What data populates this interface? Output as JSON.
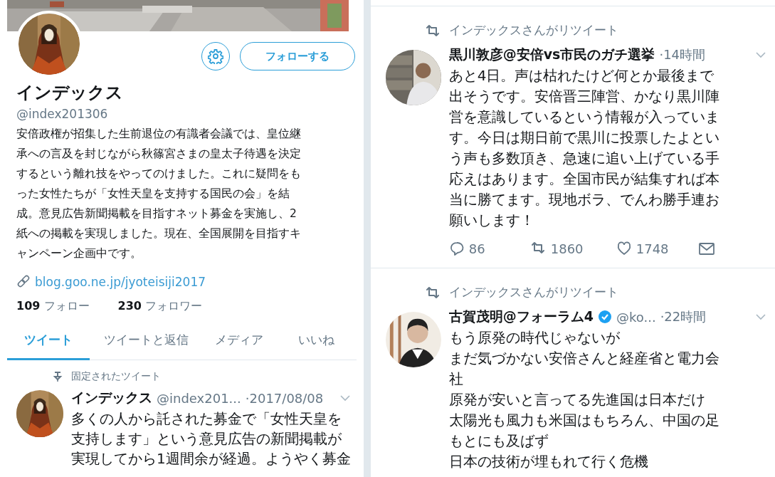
{
  "profile": {
    "name": "インデックス",
    "handle": "@index201306",
    "follow_button": "フォローする",
    "bio_lines": [
      "安倍政権が招集した生前退位の有識者会議では、皇位継",
      "承への言及を封じながら秋篠宮さまの皇太子待遇を決定",
      "するという離れ技をやってのけました。これに疑問をも",
      "った女性たちが「女性天皇を支持する国民の会」を結",
      "成。意見広告新聞掲載を目指すネット募金を実施し、2",
      "紙への掲載を実現しました。現在、全国展開を目指すキ",
      "ャンペーン企画中です。"
    ],
    "link": "blog.goo.ne.jp/jyoteisiji2017",
    "stats": [
      {
        "count": "109",
        "label": "フォロー"
      },
      {
        "count": "230",
        "label": "フォロワー"
      }
    ],
    "tabs": [
      {
        "label": "ツイート",
        "selected": true
      },
      {
        "label": "ツイートと返信",
        "selected": false
      },
      {
        "label": "メディア",
        "selected": false
      },
      {
        "label": "いいね",
        "selected": false
      }
    ]
  },
  "pinned_tweet": {
    "pinned_label": "固定されたツイート",
    "name": "インデックス",
    "handle": "@index201...",
    "time": "·2017/08/08",
    "lines": [
      "多くの人から託された募金で「女性天皇を",
      "支持します」という意見広告の新聞掲載が",
      "実現してから1週間余が経過。ようやく募金"
    ]
  },
  "timeline": [
    {
      "retweeted_by": "インデックスさんがリツイート",
      "name": "黒川敦彦@安倍vs市民のガチ選挙",
      "verified": false,
      "time": "·14時間",
      "lines": [
        "あと4日。声は枯れたけど何とか最後まで",
        "出そうです。安倍晋三陣営、かなり黒川陣",
        "営を意識しているという情報が入っていま",
        "す。今日は期日前で黒川に投票したよとい",
        "う声も多数頂き、急速に追い上げている手",
        "応えはあります。全国市民が結集すれば本",
        "当に勝てます。現地ボラ、でんわ勝手連お",
        "願いします！"
      ],
      "replies": "86",
      "retweets": "1860",
      "likes": "1748"
    },
    {
      "retweeted_by": "インデックスさんがリツイート",
      "name": "古賀茂明@フォーラム4",
      "verified": true,
      "handle": "@ko...",
      "time": "·22時間",
      "lines": [
        "もう原発の時代じゃないが",
        "まだ気づかない安倍さんと経産省と電力会",
        "社",
        "原発が安いと言ってる先進国は日本だけ",
        "太陽光も風力も米国はもちろん、中国の足",
        "もとにも及ばず",
        "日本の技術が埋もれて行く危機"
      ]
    }
  ]
}
